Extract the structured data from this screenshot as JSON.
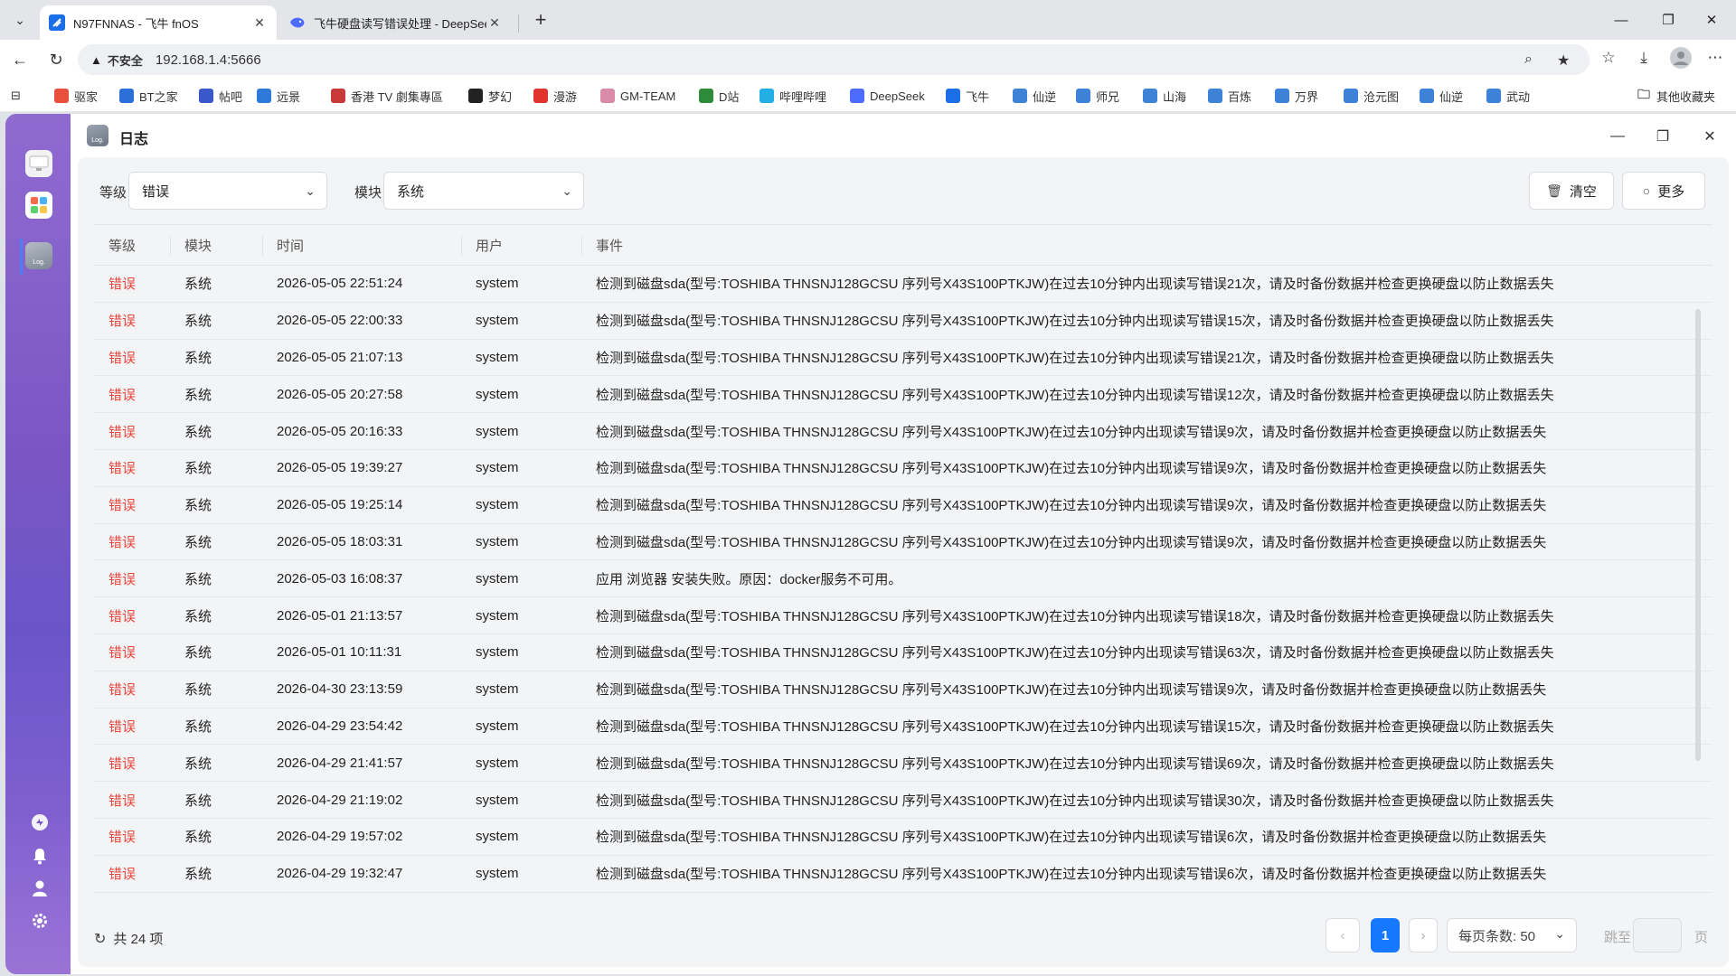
{
  "browser": {
    "tabs": [
      {
        "title": "N97FNNAS - 飞牛 fnOS",
        "active": true
      },
      {
        "title": "飞牛硬盘读写错误处理 - DeepSeek",
        "active": false
      }
    ],
    "address": {
      "security_label": "不安全",
      "url": "192.168.1.4:5666"
    },
    "bookmarks": [
      {
        "label": "驱家",
        "color": "#e84f3c"
      },
      {
        "label": "BT之家",
        "color": "#2b6fd8"
      },
      {
        "label": "帖吧",
        "color": "#3a58c9"
      },
      {
        "label": "远景",
        "color": "#2f7ad8"
      },
      {
        "label": "香港 TV 劇集專區",
        "color": "#c83a3a"
      },
      {
        "label": "梦幻",
        "color": "#222222"
      },
      {
        "label": "漫游",
        "color": "#e0342d"
      },
      {
        "label": "GM-TEAM",
        "color": "#d98aa8"
      },
      {
        "label": "D站",
        "color": "#2e8b3a"
      },
      {
        "label": "哔哩哔哩",
        "color": "#23ade5"
      },
      {
        "label": "DeepSeek",
        "color": "#4d6bfe"
      },
      {
        "label": "飞牛",
        "color": "#1b6fe6"
      },
      {
        "label": "仙逆",
        "color": "#3d82d6"
      },
      {
        "label": "师兄",
        "color": "#3d82d6"
      },
      {
        "label": "山海",
        "color": "#3d82d6"
      },
      {
        "label": "百炼",
        "color": "#3d82d6"
      },
      {
        "label": "万界",
        "color": "#3d82d6"
      },
      {
        "label": "沧元图",
        "color": "#3d82d6"
      },
      {
        "label": "仙逆",
        "color": "#3d82d6"
      },
      {
        "label": "武动",
        "color": "#3d82d6"
      }
    ],
    "other_bookmarks": "其他收藏夹"
  },
  "window": {
    "title": "日志",
    "icon_text": "Log."
  },
  "filters": {
    "level_label": "等级",
    "level_value": "错误",
    "module_label": "模块",
    "module_value": "系统",
    "clear_label": "清空",
    "more_label": "更多"
  },
  "table": {
    "headers": [
      "等级",
      "模块",
      "时间",
      "用户",
      "事件"
    ],
    "rows": [
      {
        "level": "错误",
        "module": "系统",
        "time": "2026-05-05 22:51:24",
        "user": "system",
        "event": "检测到磁盘sda(型号:TOSHIBA THNSNJ128GCSU 序列号X43S100PTKJW)在过去10分钟内出现读写错误21次，请及时备份数据并检查更换硬盘以防止数据丢失"
      },
      {
        "level": "错误",
        "module": "系统",
        "time": "2026-05-05 22:00:33",
        "user": "system",
        "event": "检测到磁盘sda(型号:TOSHIBA THNSNJ128GCSU 序列号X43S100PTKJW)在过去10分钟内出现读写错误15次，请及时备份数据并检查更换硬盘以防止数据丢失"
      },
      {
        "level": "错误",
        "module": "系统",
        "time": "2026-05-05 21:07:13",
        "user": "system",
        "event": "检测到磁盘sda(型号:TOSHIBA THNSNJ128GCSU 序列号X43S100PTKJW)在过去10分钟内出现读写错误21次，请及时备份数据并检查更换硬盘以防止数据丢失"
      },
      {
        "level": "错误",
        "module": "系统",
        "time": "2026-05-05 20:27:58",
        "user": "system",
        "event": "检测到磁盘sda(型号:TOSHIBA THNSNJ128GCSU 序列号X43S100PTKJW)在过去10分钟内出现读写错误12次，请及时备份数据并检查更换硬盘以防止数据丢失"
      },
      {
        "level": "错误",
        "module": "系统",
        "time": "2026-05-05 20:16:33",
        "user": "system",
        "event": "检测到磁盘sda(型号:TOSHIBA THNSNJ128GCSU 序列号X43S100PTKJW)在过去10分钟内出现读写错误9次，请及时备份数据并检查更换硬盘以防止数据丢失"
      },
      {
        "level": "错误",
        "module": "系统",
        "time": "2026-05-05 19:39:27",
        "user": "system",
        "event": "检测到磁盘sda(型号:TOSHIBA THNSNJ128GCSU 序列号X43S100PTKJW)在过去10分钟内出现读写错误9次，请及时备份数据并检查更换硬盘以防止数据丢失"
      },
      {
        "level": "错误",
        "module": "系统",
        "time": "2026-05-05 19:25:14",
        "user": "system",
        "event": "检测到磁盘sda(型号:TOSHIBA THNSNJ128GCSU 序列号X43S100PTKJW)在过去10分钟内出现读写错误9次，请及时备份数据并检查更换硬盘以防止数据丢失"
      },
      {
        "level": "错误",
        "module": "系统",
        "time": "2026-05-05 18:03:31",
        "user": "system",
        "event": "检测到磁盘sda(型号:TOSHIBA THNSNJ128GCSU 序列号X43S100PTKJW)在过去10分钟内出现读写错误9次，请及时备份数据并检查更换硬盘以防止数据丢失"
      },
      {
        "level": "错误",
        "module": "系统",
        "time": "2026-05-03 16:08:37",
        "user": "system",
        "event": "应用 浏览器 安装失败。原因：docker服务不可用。"
      },
      {
        "level": "错误",
        "module": "系统",
        "time": "2026-05-01 21:13:57",
        "user": "system",
        "event": "检测到磁盘sda(型号:TOSHIBA THNSNJ128GCSU 序列号X43S100PTKJW)在过去10分钟内出现读写错误18次，请及时备份数据并检查更换硬盘以防止数据丢失"
      },
      {
        "level": "错误",
        "module": "系统",
        "time": "2026-05-01 10:11:31",
        "user": "system",
        "event": "检测到磁盘sda(型号:TOSHIBA THNSNJ128GCSU 序列号X43S100PTKJW)在过去10分钟内出现读写错误63次，请及时备份数据并检查更换硬盘以防止数据丢失"
      },
      {
        "level": "错误",
        "module": "系统",
        "time": "2026-04-30 23:13:59",
        "user": "system",
        "event": "检测到磁盘sda(型号:TOSHIBA THNSNJ128GCSU 序列号X43S100PTKJW)在过去10分钟内出现读写错误9次，请及时备份数据并检查更换硬盘以防止数据丢失"
      },
      {
        "level": "错误",
        "module": "系统",
        "time": "2026-04-29 23:54:42",
        "user": "system",
        "event": "检测到磁盘sda(型号:TOSHIBA THNSNJ128GCSU 序列号X43S100PTKJW)在过去10分钟内出现读写错误15次，请及时备份数据并检查更换硬盘以防止数据丢失"
      },
      {
        "level": "错误",
        "module": "系统",
        "time": "2026-04-29 21:41:57",
        "user": "system",
        "event": "检测到磁盘sda(型号:TOSHIBA THNSNJ128GCSU 序列号X43S100PTKJW)在过去10分钟内出现读写错误69次，请及时备份数据并检查更换硬盘以防止数据丢失"
      },
      {
        "level": "错误",
        "module": "系统",
        "time": "2026-04-29 21:19:02",
        "user": "system",
        "event": "检测到磁盘sda(型号:TOSHIBA THNSNJ128GCSU 序列号X43S100PTKJW)在过去10分钟内出现读写错误30次，请及时备份数据并检查更换硬盘以防止数据丢失"
      },
      {
        "level": "错误",
        "module": "系统",
        "time": "2026-04-29 19:57:02",
        "user": "system",
        "event": "检测到磁盘sda(型号:TOSHIBA THNSNJ128GCSU 序列号X43S100PTKJW)在过去10分钟内出现读写错误6次，请及时备份数据并检查更换硬盘以防止数据丢失"
      },
      {
        "level": "错误",
        "module": "系统",
        "time": "2026-04-29 19:32:47",
        "user": "system",
        "event": "检测到磁盘sda(型号:TOSHIBA THNSNJ128GCSU 序列号X43S100PTKJW)在过去10分钟内出现读写错误6次，请及时备份数据并检查更换硬盘以防止数据丢失"
      }
    ]
  },
  "footer": {
    "total": "共 24 项",
    "current_page": "1",
    "page_size": "每页条数: 50",
    "jump_label": "跳至",
    "page_unit": "页"
  },
  "colors": {
    "error": "#e8453c",
    "primary": "#1677ff",
    "dock": "#7a56c4"
  }
}
